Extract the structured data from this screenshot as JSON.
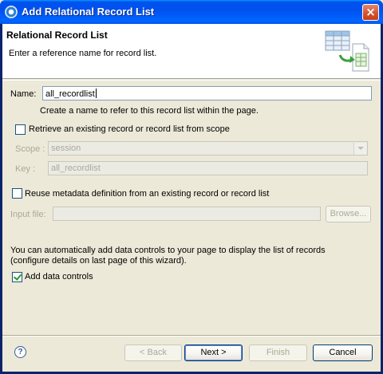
{
  "window": {
    "title": "Add Relational Record List"
  },
  "banner": {
    "title": "Relational Record List",
    "description": "Enter a reference name for record list."
  },
  "form": {
    "name_label": "Name:",
    "name_value": "all_recordlist",
    "name_hint": "Create a name to refer to this record list within the page.",
    "retrieve_label": "Retrieve an existing record or record list from scope",
    "retrieve_checked": false,
    "scope_label": "Scope :",
    "scope_value": "session",
    "key_label": "Key :",
    "key_value": "all_recordlist",
    "reuse_label": "Reuse metadata definition from an existing record or record list",
    "reuse_checked": false,
    "input_file_label": "Input file:",
    "input_file_value": "",
    "browse_label": "Browse...",
    "info_text_1": "You can automatically add data controls to your page to display the list of records",
    "info_text_2": "(configure details on last page of this wizard).",
    "add_controls_label": "Add data controls",
    "add_controls_checked": true
  },
  "buttons": {
    "back": "< Back",
    "next": "Next >",
    "finish": "Finish",
    "cancel": "Cancel"
  },
  "icons": {
    "help": "help-icon",
    "close": "close-icon",
    "banner": "record-list-wizard-icon"
  },
  "colors": {
    "titlebar": "#0053ee",
    "dialog_bg": "#ece9d8",
    "disabled_text": "#aca899"
  }
}
